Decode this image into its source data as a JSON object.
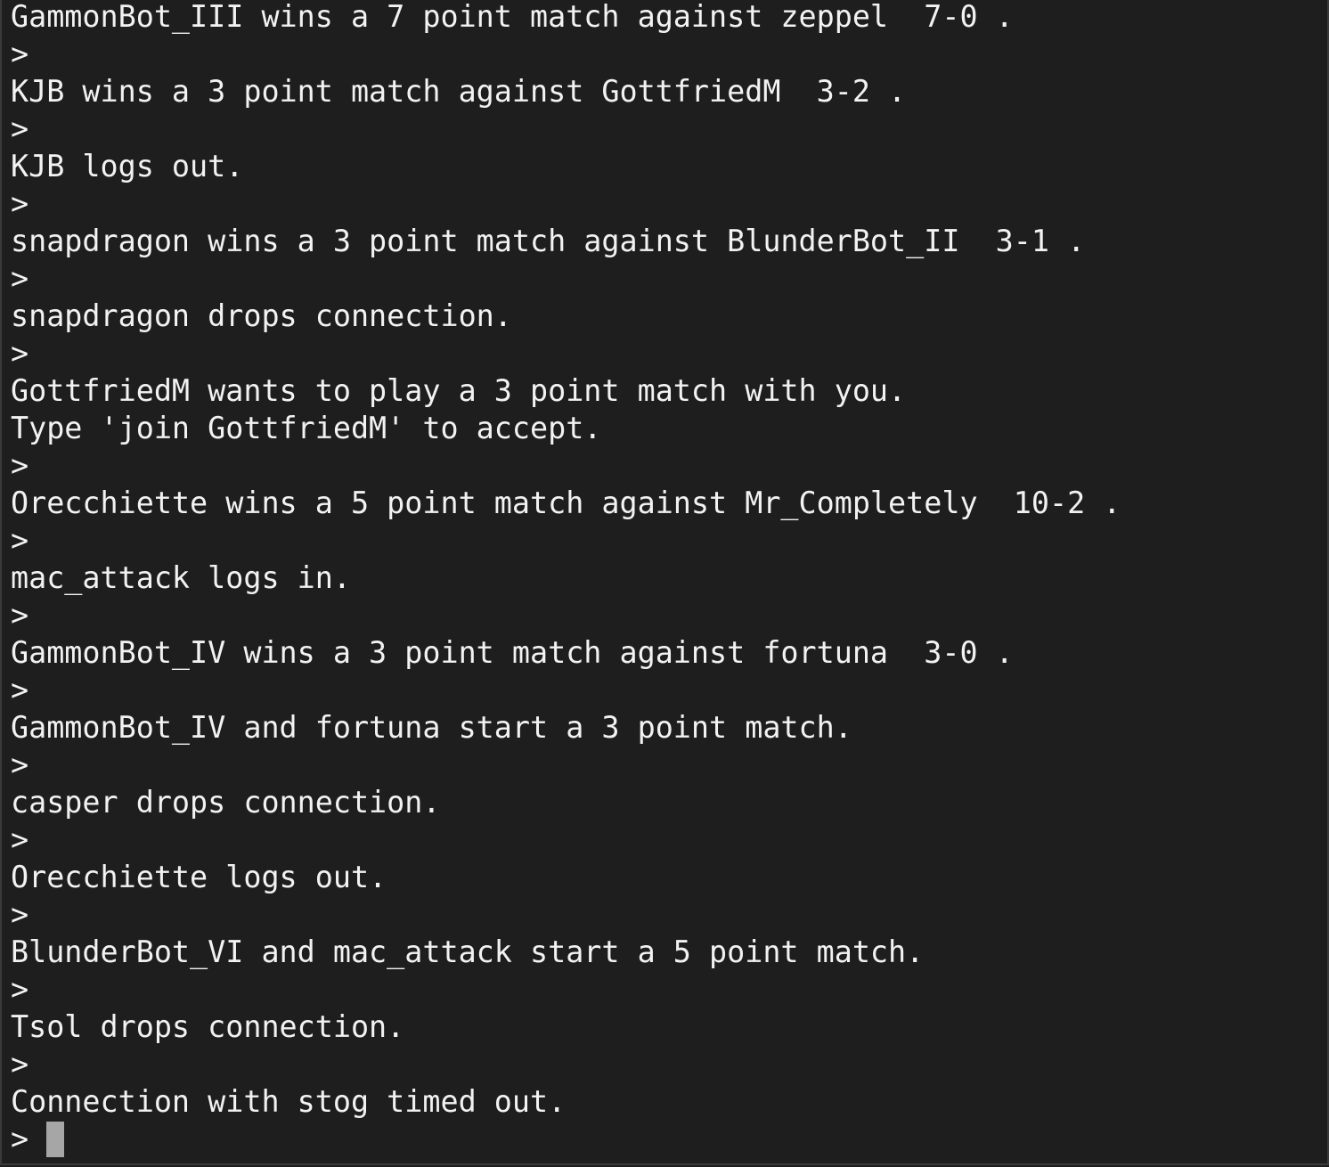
{
  "terminal": {
    "lines": [
      "GammonBot_III wins a 7 point match against zeppel  7-0 .",
      ">",
      "KJB wins a 3 point match against GottfriedM  3-2 .",
      ">",
      "KJB logs out.",
      ">",
      "snapdragon wins a 3 point match against BlunderBot_II  3-1 .",
      ">",
      "snapdragon drops connection.",
      ">",
      "GottfriedM wants to play a 3 point match with you.",
      "Type 'join GottfriedM' to accept.",
      ">",
      "Orecchiette wins a 5 point match against Mr_Completely  10-2 .",
      ">",
      "mac_attack logs in.",
      ">",
      "GammonBot_IV wins a 3 point match against fortuna  3-0 .",
      ">",
      "GammonBot_IV and fortuna start a 3 point match.",
      ">",
      "casper drops connection.",
      ">",
      "Orecchiette logs out.",
      ">",
      "BlunderBot_VI and mac_attack start a 5 point match.",
      ">",
      "Tsol drops connection.",
      ">",
      "Connection with stog timed out."
    ],
    "prompt": "> "
  },
  "colors": {
    "background": "#1e1e1e",
    "text": "#f2f2f2",
    "cursor": "#a6a6a6"
  }
}
